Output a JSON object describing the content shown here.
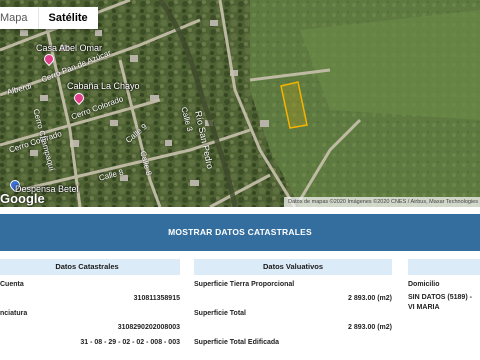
{
  "map": {
    "tabs": [
      {
        "label": "Mapa",
        "active": false
      },
      {
        "label": "Satélite",
        "active": true
      }
    ],
    "places": [
      {
        "name": "Casa Abel Omar"
      },
      {
        "name": "Cabaña La Chayo"
      },
      {
        "name": "Despensa Betel"
      }
    ],
    "streets": [
      {
        "name": "Cerro Pan de Azúcar"
      },
      {
        "name": "Cerro Colorado"
      },
      {
        "name": "Cerro Colorado"
      },
      {
        "name": "Alberdi"
      },
      {
        "name": "Calle 9"
      },
      {
        "name": "Calle 8"
      },
      {
        "name": "Calle 8"
      },
      {
        "name": "Calle 3"
      },
      {
        "name": "Cerro Champaquí"
      }
    ],
    "river": "Río San Pedro",
    "logo": "Google",
    "attribution": "Datos de mapas ©2020 Imágenes ©2020 CNES / Airbus, Maxar Technologies",
    "colors": {
      "parcel": "#f4b400",
      "pin": "#e0408a"
    }
  },
  "banner": {
    "label": "MOSTRAR DATOS CATASTRALES"
  },
  "catastrales": {
    "title": "Datos Catastrales",
    "rows": [
      {
        "label": "Cuenta",
        "value": "310811358915"
      },
      {
        "label": "nciatura",
        "value": "3108290202008003"
      },
      {
        "label": "",
        "value": "31 - 08 - 29 - 02 - 02 - 008 - 003"
      }
    ]
  },
  "valuativos": {
    "title": "Datos Valuativos",
    "rows": [
      {
        "label": "Superficie Tierra Proporcional",
        "value": "2 893.00 (m2)"
      },
      {
        "label": "Superficie Total",
        "value": "2 893.00 (m2)"
      },
      {
        "label": "Superficie Total Edificada",
        "value": ""
      }
    ]
  },
  "domicilio": {
    "title": "Domicilio",
    "value": "SIN DATOS (5189) - VI MARIA"
  },
  "theme": {
    "banner": "#336e9f",
    "panel_head": "#dcebf8"
  }
}
